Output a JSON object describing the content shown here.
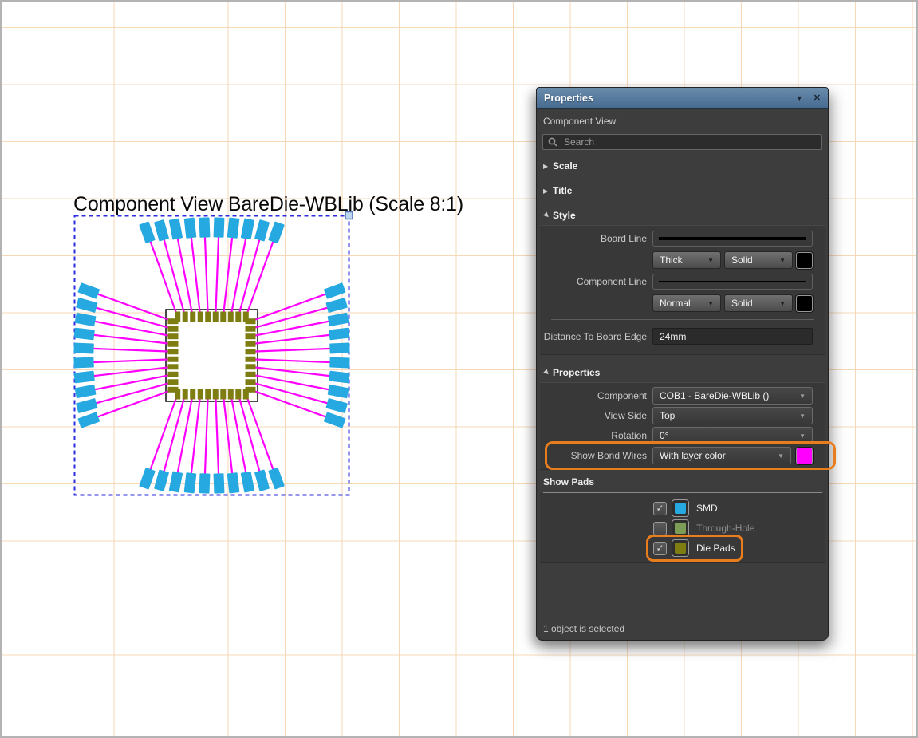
{
  "figure": {
    "title": "Component View BareDie-WBLib (Scale 8:1)",
    "pads_per_side": 10,
    "colors": {
      "bond_wire": "#ff00ff",
      "smd_pad": "#26a9e0",
      "die_pad": "#7d7d12",
      "die_outline": "#1c1c1c",
      "selection": "#2d2de0",
      "grid_line": "#f6d7b6",
      "highlight": "#e87d1e"
    }
  },
  "panel": {
    "title": "Properties",
    "view_type": "Component View",
    "search_placeholder": "Search",
    "sections": {
      "scale": "Scale",
      "title": "Title",
      "style": "Style",
      "properties": "Properties"
    },
    "style": {
      "board_line_label": "Board Line",
      "board_line_width": "Thick",
      "board_line_style": "Solid",
      "board_line_color": "#000000",
      "component_line_label": "Component Line",
      "component_line_width": "Normal",
      "component_line_style": "Solid",
      "component_line_color": "#000000",
      "distance_label": "Distance To Board Edge",
      "distance_value": "24mm"
    },
    "properties": {
      "component_label": "Component",
      "component_value": "COB1 - BareDie-WBLib ()",
      "view_side_label": "View Side",
      "view_side_value": "Top",
      "rotation_label": "Rotation",
      "rotation_value": "0°",
      "show_bond_wires_label": "Show Bond Wires",
      "show_bond_wires_value": "With layer color",
      "bond_wire_color": "#ff00ff"
    },
    "show_pads": {
      "label": "Show Pads",
      "items": [
        {
          "label": "SMD",
          "checked": true,
          "enabled": true,
          "color": "#26a9e0",
          "highlighted": false
        },
        {
          "label": "Through-Hole",
          "checked": false,
          "enabled": false,
          "color": "#7d9c55",
          "highlighted": false
        },
        {
          "label": "Die Pads",
          "checked": true,
          "enabled": true,
          "color": "#7d7d12",
          "highlighted": true
        }
      ]
    },
    "status": "1 object is selected"
  }
}
